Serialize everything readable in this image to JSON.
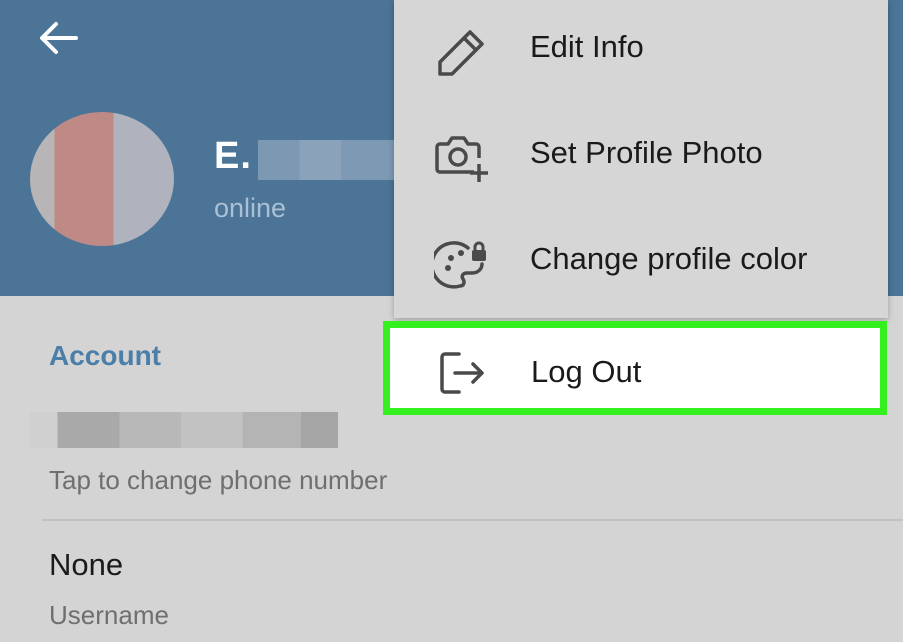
{
  "header": {
    "back_icon": "arrow-left-icon",
    "name": "E.",
    "status": "online"
  },
  "account": {
    "section_title": "Account",
    "phone_hint": "Tap to change phone number",
    "username_value": "None",
    "username_label": "Username"
  },
  "menu": {
    "items": [
      {
        "label": "Edit Info",
        "icon": "pencil-icon"
      },
      {
        "label": "Set Profile Photo",
        "icon": "camera-plus-icon"
      },
      {
        "label": "Change profile color",
        "icon": "palette-lock-icon"
      },
      {
        "label": "Log Out",
        "icon": "logout-icon"
      }
    ]
  },
  "colors": {
    "header_bg": "#4b7497",
    "accent": "#4b7ea8",
    "highlight_border": "#34f01e",
    "page_bg": "#d4d4d4"
  }
}
